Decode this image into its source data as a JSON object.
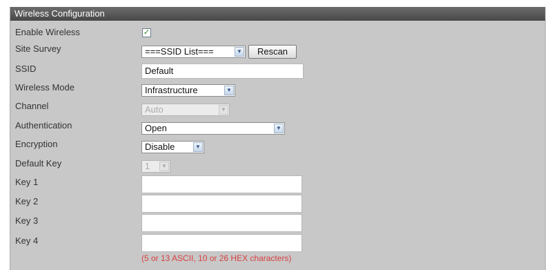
{
  "title": "Wireless Configuration",
  "labels": {
    "enable_wireless": "Enable Wireless",
    "site_survey": "Site Survey",
    "ssid": "SSID",
    "wireless_mode": "Wireless Mode",
    "channel": "Channel",
    "authentication": "Authentication",
    "encryption": "Encryption",
    "default_key": "Default Key",
    "key1": "Key 1",
    "key2": "Key 2",
    "key3": "Key 3",
    "key4": "Key 4"
  },
  "values": {
    "enable_wireless_checked": true,
    "site_survey": "===SSID List===",
    "rescan_label": "Rescan",
    "ssid": "Default",
    "wireless_mode": "Infrastructure",
    "channel": "Auto",
    "authentication": "Open",
    "encryption": "Disable",
    "default_key": "1",
    "key1": "",
    "key2": "",
    "key3": "",
    "key4": ""
  },
  "hint": "(5 or 13 ASCII, 10 or 26 HEX characters)",
  "icons": {
    "checkbox": "check-icon",
    "dropdown": "chevron-down-icon"
  },
  "colors": {
    "header_bg": "#474747",
    "panel_bg": "#c8c8c8",
    "hint": "#d94040"
  }
}
